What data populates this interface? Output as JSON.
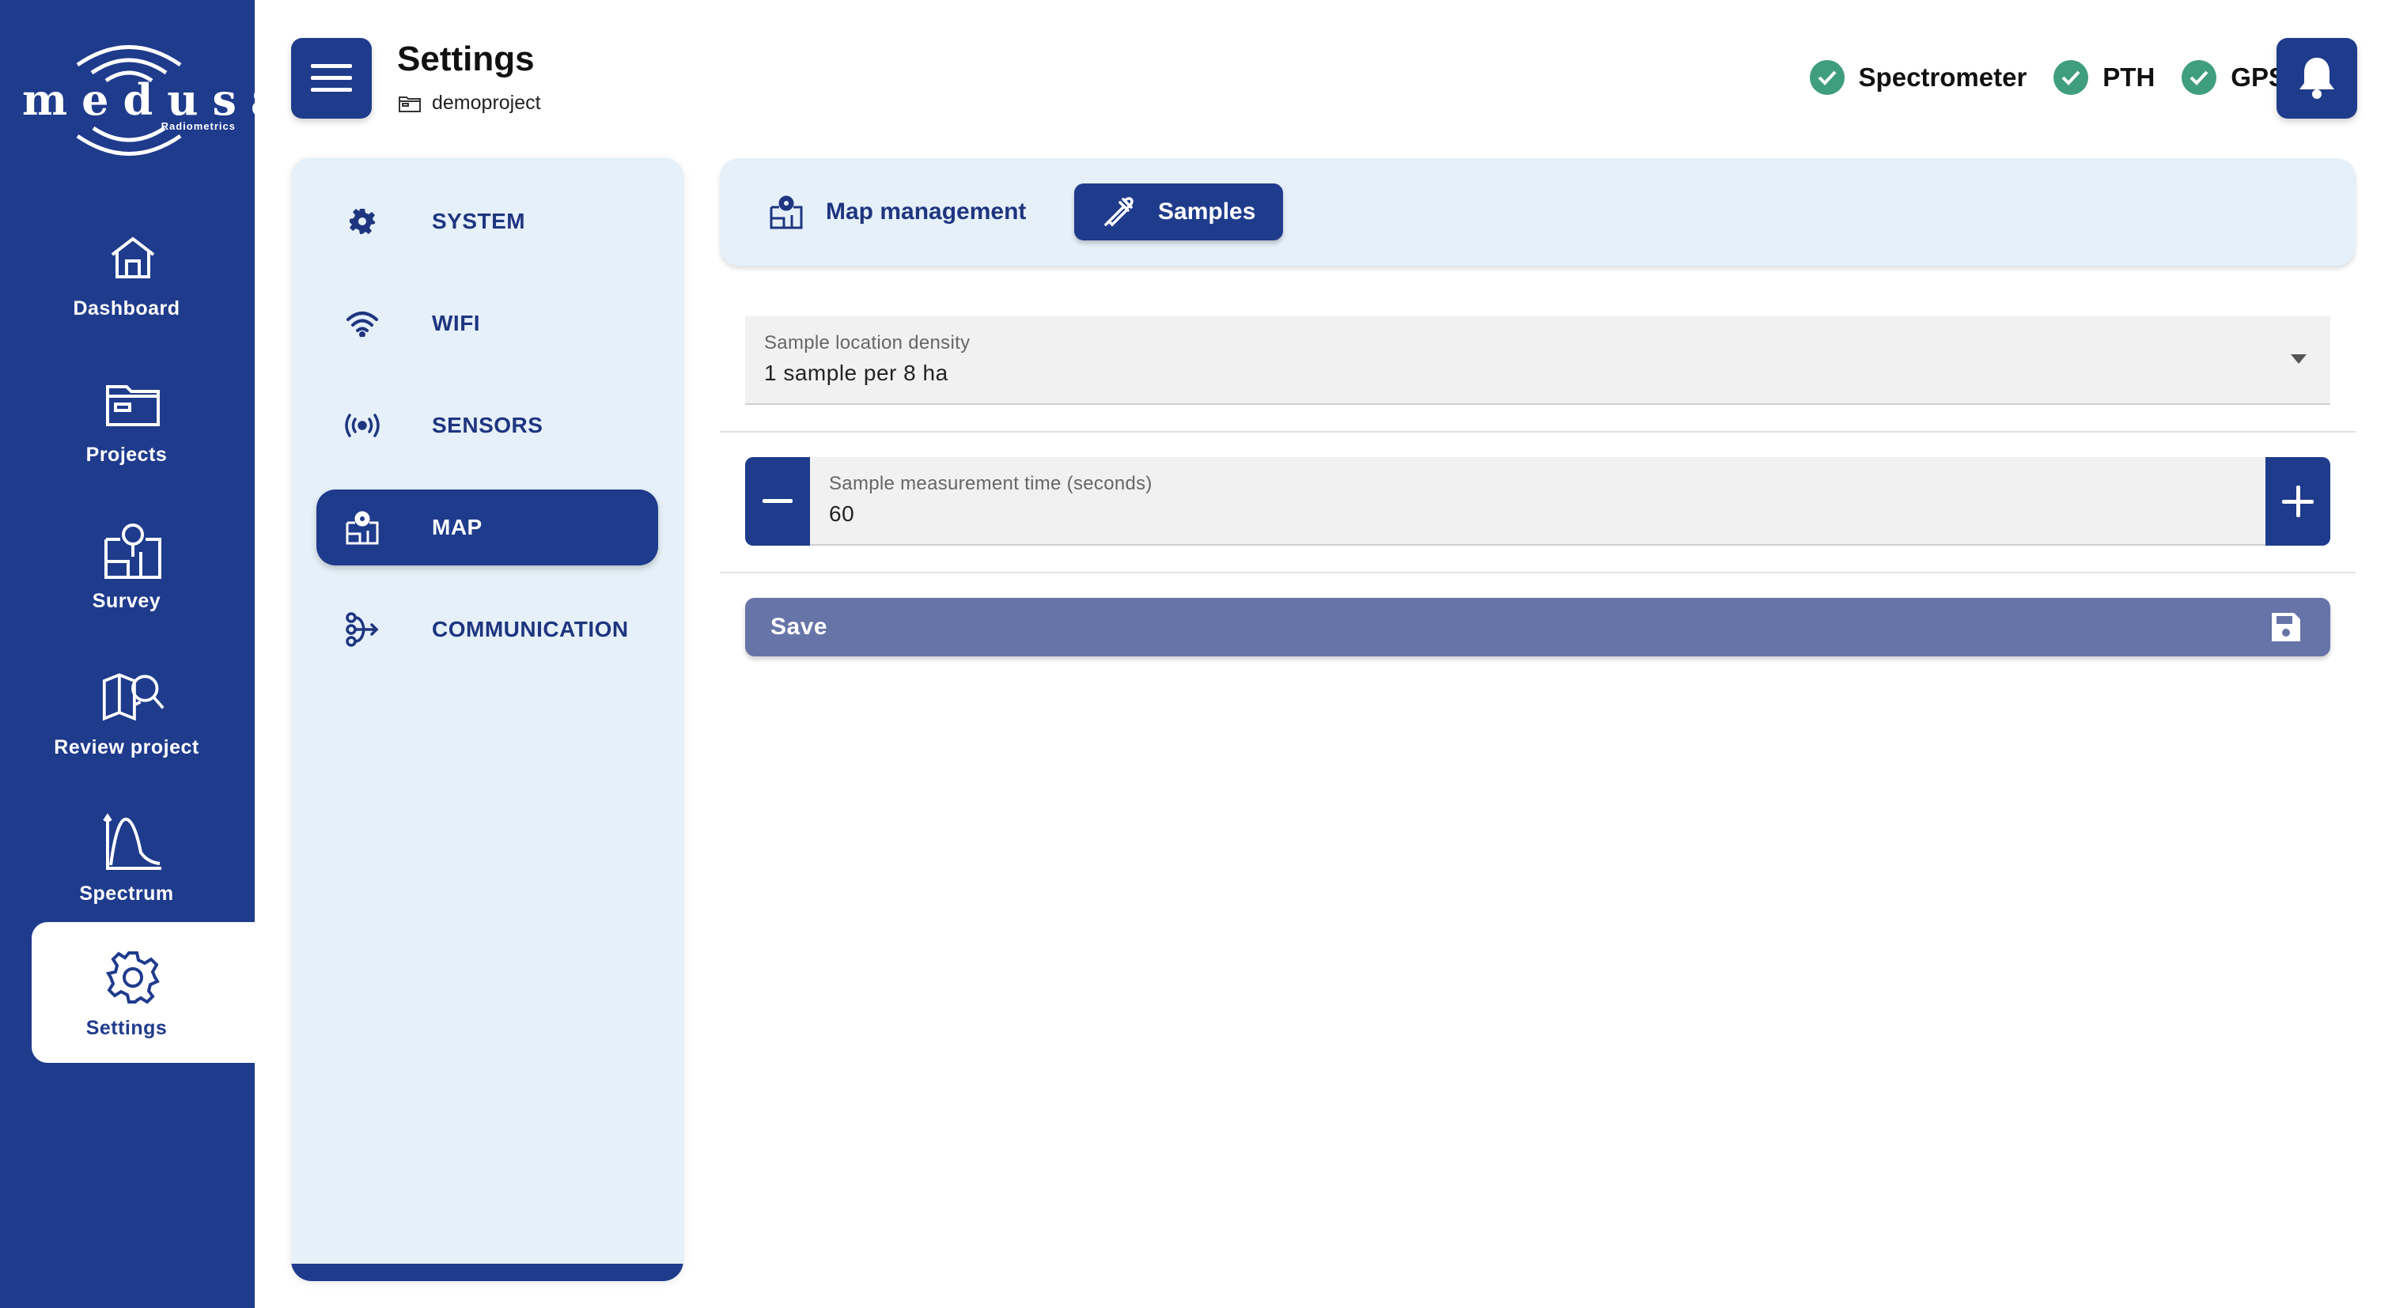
{
  "brand": {
    "name": "medusa",
    "tagline": "Radiometrics"
  },
  "colors": {
    "primary": "#1f3b8c",
    "panel": "#e5f0f8",
    "status_ok": "#3f9e7d",
    "save": "#6674a8"
  },
  "nav": {
    "items": [
      {
        "label": "Dashboard",
        "icon": "home-icon"
      },
      {
        "label": "Projects",
        "icon": "folder-icon"
      },
      {
        "label": "Survey",
        "icon": "map-pin-icon"
      },
      {
        "label": "Review project",
        "icon": "map-search-icon"
      },
      {
        "label": "Spectrum",
        "icon": "spectrum-chart-icon"
      },
      {
        "label": "Settings",
        "icon": "gear-icon",
        "active": true
      }
    ]
  },
  "header": {
    "title": "Settings",
    "project": "demoproject",
    "status": [
      {
        "label": "Spectrometer",
        "state": "ok"
      },
      {
        "label": "PTH",
        "state": "ok"
      },
      {
        "label": "GPS",
        "state": "ok"
      }
    ]
  },
  "categories": [
    {
      "label": "SYSTEM",
      "icon": "gear-icon"
    },
    {
      "label": "WIFI",
      "icon": "wifi-icon"
    },
    {
      "label": "SENSORS",
      "icon": "broadcast-icon"
    },
    {
      "label": "MAP",
      "icon": "map-icon",
      "active": true
    },
    {
      "label": "COMMUNICATION",
      "icon": "share-icon"
    }
  ],
  "tabs": [
    {
      "label": "Map management",
      "icon": "map-icon"
    },
    {
      "label": "Samples",
      "icon": "eyedropper-icon",
      "active": true
    }
  ],
  "form": {
    "density": {
      "label": "Sample location density",
      "value": "1 sample per 8 ha"
    },
    "time": {
      "label": "Sample measurement time (seconds)",
      "value": "60"
    },
    "save_label": "Save"
  }
}
